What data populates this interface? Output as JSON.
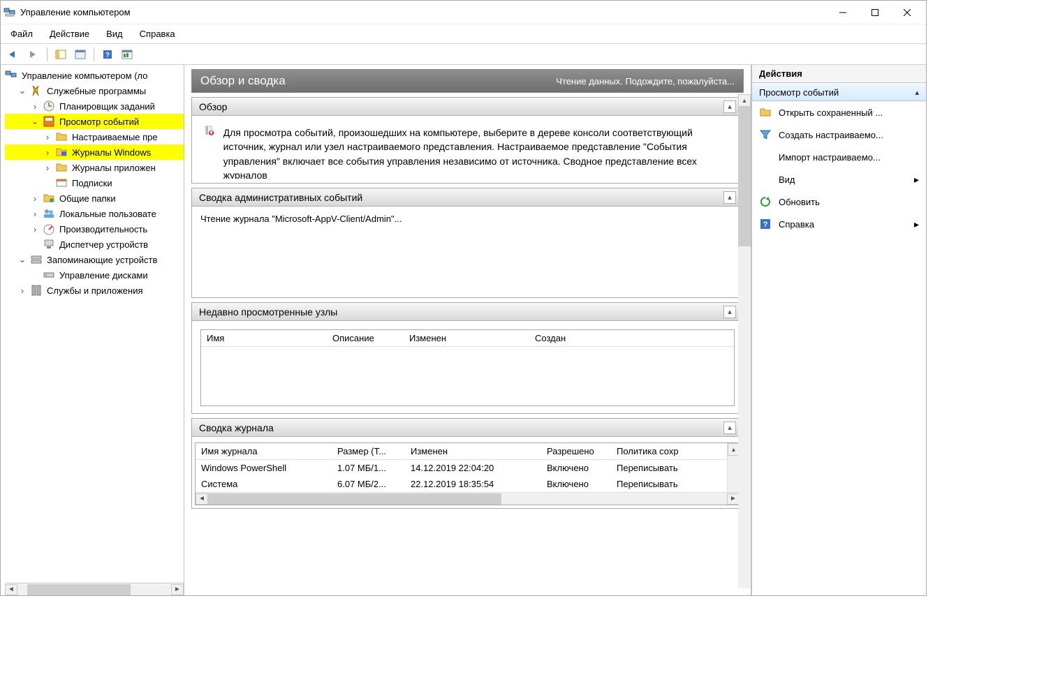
{
  "window": {
    "title": "Управление компьютером"
  },
  "menu": {
    "file": "Файл",
    "action": "Действие",
    "view": "Вид",
    "help": "Справка"
  },
  "tree": {
    "root": "Управление компьютером (ло",
    "utilities": "Служебные программы",
    "scheduler": "Планировщик заданий",
    "event_viewer": "Просмотр событий",
    "custom_views": "Настраиваемые пре",
    "win_logs": "Журналы Windows",
    "app_logs": "Журналы приложен",
    "subscriptions": "Подписки",
    "shared": "Общие папки",
    "local_users": "Локальные пользовате",
    "performance": "Производительность",
    "devmgr": "Диспетчер устройств",
    "storage": "Запоминающие устройств",
    "diskmgmt": "Управление дисками",
    "services": "Службы и приложения"
  },
  "center": {
    "header_title": "Обзор и сводка",
    "header_status": "Чтение данных. Подождите, пожалуйста...",
    "sec_overview": "Обзор",
    "overview_text": "Для просмотра событий, произошедших на компьютере, выберите в дереве консоли соответствующий источник, журнал или узел настраиваемого представления. Настраиваемое представление \"События управления\" включает все события управления независимо от источника. Сводное представление всех журналов",
    "sec_admin": "Сводка административных событий",
    "admin_body": "Чтение журнала \"Microsoft-AppV-Client/Admin\"...",
    "sec_recent": "Недавно просмотренные узлы",
    "recent_cols": {
      "name": "Имя",
      "desc": "Описание",
      "modified": "Изменен",
      "created": "Создан"
    },
    "sec_logs": "Сводка журнала",
    "log_cols": {
      "name": "Имя журнала",
      "size": "Размер (Т...",
      "modified": "Изменен",
      "allowed": "Разрешено",
      "policy": "Политика сохр"
    },
    "log_rows": [
      {
        "name": "Windows PowerShell",
        "size": "1.07 МБ/1...",
        "modified": "14.12.2019 22:04:20",
        "allowed": "Включено",
        "policy": "Переписывать"
      },
      {
        "name": "Система",
        "size": "6.07 МБ/2...",
        "modified": "22.12.2019 18:35:54",
        "allowed": "Включено",
        "policy": "Переписывать"
      }
    ]
  },
  "actions": {
    "title": "Действия",
    "group": "Просмотр событий",
    "open_saved": "Открыть сохраненный ...",
    "create_custom": "Создать настраиваемо...",
    "import_custom": "Импорт настраиваемо...",
    "view": "Вид",
    "refresh": "Обновить",
    "help": "Справка"
  }
}
